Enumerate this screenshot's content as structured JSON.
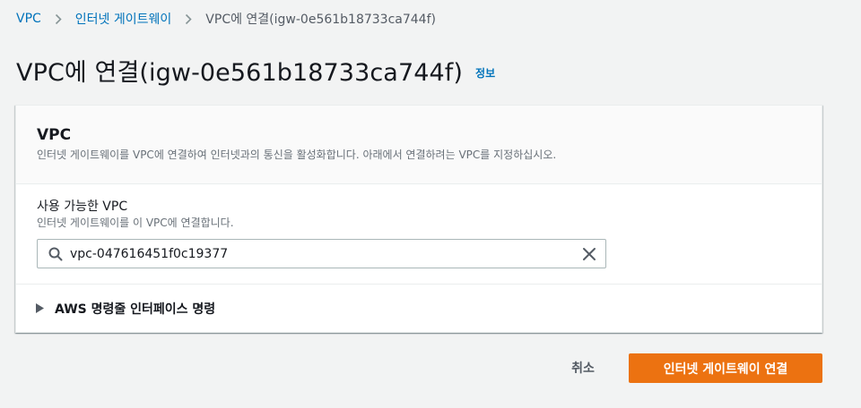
{
  "breadcrumb": {
    "items": [
      "VPC",
      "인터넷 게이트웨이",
      "VPC에 연결(igw-0e561b18733ca744f)"
    ]
  },
  "header": {
    "title": "VPC에 연결(igw-0e561b18733ca744f)",
    "info_link": "정보"
  },
  "panel": {
    "title": "VPC",
    "description": "인터넷 게이트웨이를 VPC에 연결하여 인터넷과의 통신을 활성화합니다. 아래에서 연결하려는 VPC를 지정하십시오.",
    "field": {
      "label": "사용 가능한 VPC",
      "description": "인터넷 게이트웨이를 이 VPC에 연결합니다.",
      "value": "vpc-047616451f0c19377"
    },
    "expander_label": "AWS 명령줄 인터페이스 명령"
  },
  "actions": {
    "cancel_label": "취소",
    "submit_label": "인터넷 게이트웨이 연결"
  },
  "colors": {
    "link": "#0073bb",
    "primary": "#ec7211",
    "background": "#f2f3f3"
  },
  "icons": [
    "chevron-right-icon",
    "search-icon",
    "close-icon",
    "caret-right-icon"
  ]
}
